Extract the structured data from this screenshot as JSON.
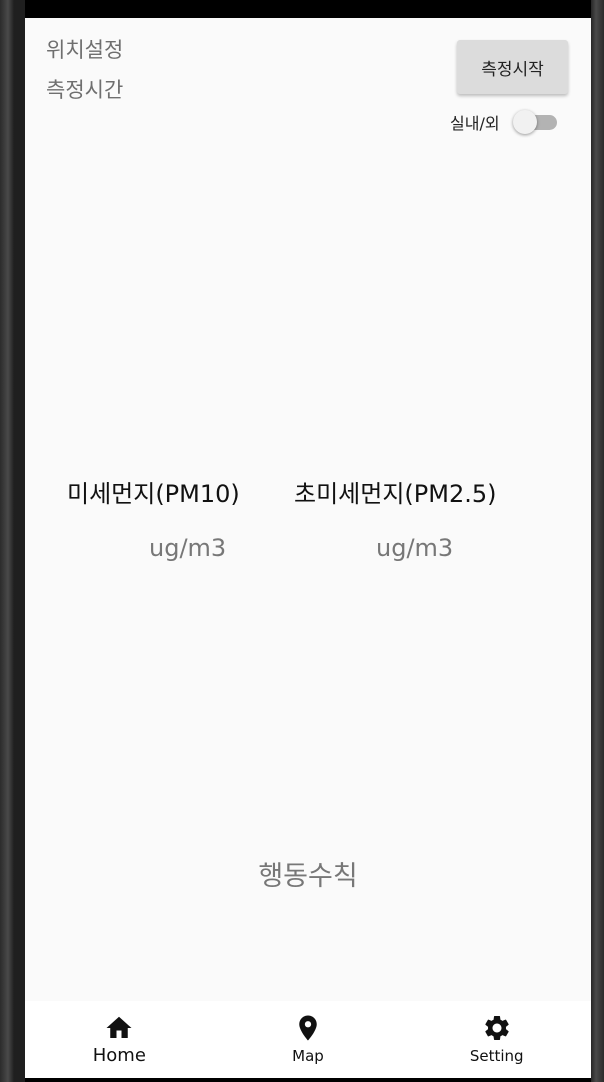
{
  "header": {
    "location_label": "위치설정",
    "time_label": "측정시간",
    "start_button": "측정시작",
    "indoor_outdoor_label": "실내/외",
    "indoor_outdoor_on": false
  },
  "measurements": {
    "pm10": {
      "title": "미세먼지(PM10)",
      "unit": "ug/m3"
    },
    "pm25": {
      "title": "초미세먼지(PM2.5)",
      "unit": "ug/m3"
    }
  },
  "activity_label": "행동수칙",
  "nav": {
    "items": [
      {
        "label": "Home",
        "icon": "home-icon",
        "active": true
      },
      {
        "label": "Map",
        "icon": "map-pin-icon",
        "active": false
      },
      {
        "label": "Setting",
        "icon": "gear-icon",
        "active": false
      }
    ]
  }
}
